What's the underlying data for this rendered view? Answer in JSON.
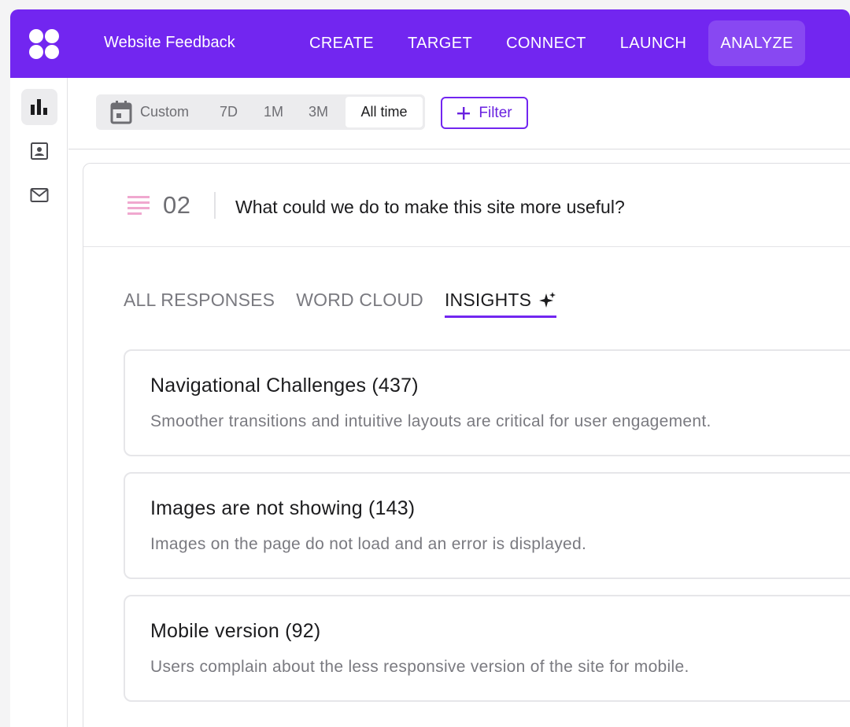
{
  "app": {
    "logo_icon": "logo-icon",
    "accent_color": "#7226f0",
    "project_title": "Website Feedback"
  },
  "nav": {
    "items": [
      {
        "label": "CREATE"
      },
      {
        "label": "TARGET"
      },
      {
        "label": "CONNECT"
      },
      {
        "label": "LAUNCH"
      },
      {
        "label": "ANALYZE",
        "active": true
      }
    ]
  },
  "sidebar": {
    "items": [
      {
        "icon": "bar-chart-icon",
        "active": true
      },
      {
        "icon": "contact-card-icon"
      },
      {
        "icon": "mail-icon"
      }
    ]
  },
  "toolbar": {
    "date_range": {
      "custom_label": "Custom",
      "options": [
        "7D",
        "1M",
        "3M",
        "All time"
      ],
      "selected": "All time"
    },
    "filter_label": "Filter"
  },
  "question": {
    "number": "02",
    "text": "What could we do to make this site more useful?"
  },
  "tabs": [
    {
      "label": "ALL RESPONSES"
    },
    {
      "label": "WORD CLOUD"
    },
    {
      "label": "INSIGHTS",
      "active": true,
      "icon": "sparkle-icon"
    }
  ],
  "insights": [
    {
      "title": "Navigational Challenges (437)",
      "description": "Smoother transitions and intuitive layouts are critical for user engagement."
    },
    {
      "title": "Images are not showing (143)",
      "description": "Images on the page do not load and an error is displayed."
    },
    {
      "title": "Mobile version (92)",
      "description": "Users complain about the less responsive version of the site for mobile."
    }
  ]
}
